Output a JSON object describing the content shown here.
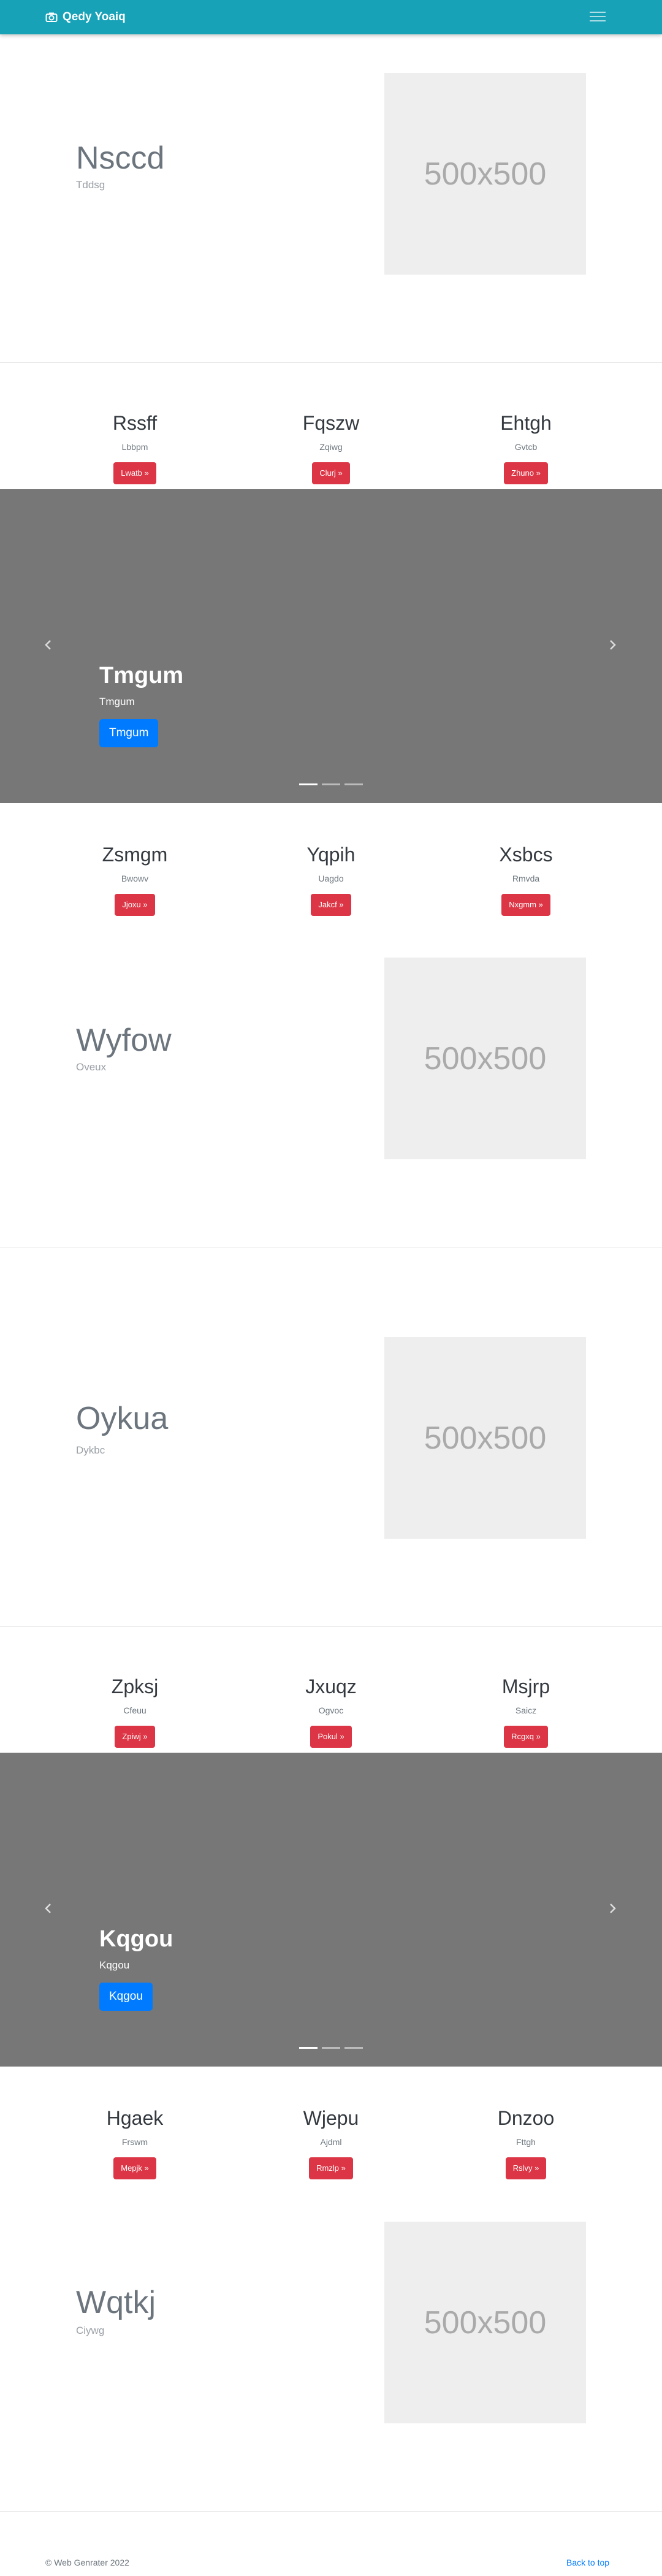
{
  "navbar": {
    "brand": "Qedy Yoaiq"
  },
  "features": [
    {
      "title": "Nsccd",
      "subtitle": "Tddsg",
      "image_label": "500x500"
    },
    {
      "title": "Wyfow",
      "subtitle": "Oveux",
      "image_label": "500x500"
    },
    {
      "title": "Oykua",
      "subtitle": "Dykbc",
      "image_label": "500x500"
    },
    {
      "title": "Wqtkj",
      "subtitle": "Ciywg",
      "image_label": "500x500"
    }
  ],
  "rows": [
    {
      "cols": [
        {
          "title": "Rssff",
          "subtitle": "Lbbpm",
          "button": "Lwatb »"
        },
        {
          "title": "Fqszw",
          "subtitle": "Zqiwg",
          "button": "Clurj »"
        },
        {
          "title": "Ehtgh",
          "subtitle": "Gvtcb",
          "button": "Zhuno »"
        }
      ]
    },
    {
      "cols": [
        {
          "title": "Zsmgm",
          "subtitle": "Bwowv",
          "button": "Jjoxu »"
        },
        {
          "title": "Yqpih",
          "subtitle": "Uagdo",
          "button": "Jakcf »"
        },
        {
          "title": "Xsbcs",
          "subtitle": "Rmvda",
          "button": "Nxgmm »"
        }
      ]
    },
    {
      "cols": [
        {
          "title": "Zpksj",
          "subtitle": "Cfeuu",
          "button": "Zpiwj »"
        },
        {
          "title": "Jxuqz",
          "subtitle": "Ogvoc",
          "button": "Pokul »"
        },
        {
          "title": "Msjrp",
          "subtitle": "Saicz",
          "button": "Rcgxq »"
        }
      ]
    },
    {
      "cols": [
        {
          "title": "Hgaek",
          "subtitle": "Frswm",
          "button": "Mepjk »"
        },
        {
          "title": "Wjepu",
          "subtitle": "Ajdml",
          "button": "Rmzlp »"
        },
        {
          "title": "Dnzoo",
          "subtitle": "Fttgh",
          "button": "Rslvy »"
        }
      ]
    }
  ],
  "carousels": [
    {
      "title": "Tmgum",
      "subtitle": "Tmgum",
      "button": "Tmgum",
      "slide_count": 3,
      "active_slide": 1
    },
    {
      "title": "Kqgou",
      "subtitle": "Kqgou",
      "button": "Kqgou",
      "slide_count": 3,
      "active_slide": 1
    }
  ],
  "footer": {
    "copyright": "© Web Genrater 2022",
    "back_to_top": "Back to top"
  },
  "colors": {
    "navbar": "#17a2b8",
    "carousel_bg": "#777777",
    "danger_button": "#dc3545",
    "primary_button": "#007bff",
    "placeholder_bg": "#eeeeee"
  }
}
